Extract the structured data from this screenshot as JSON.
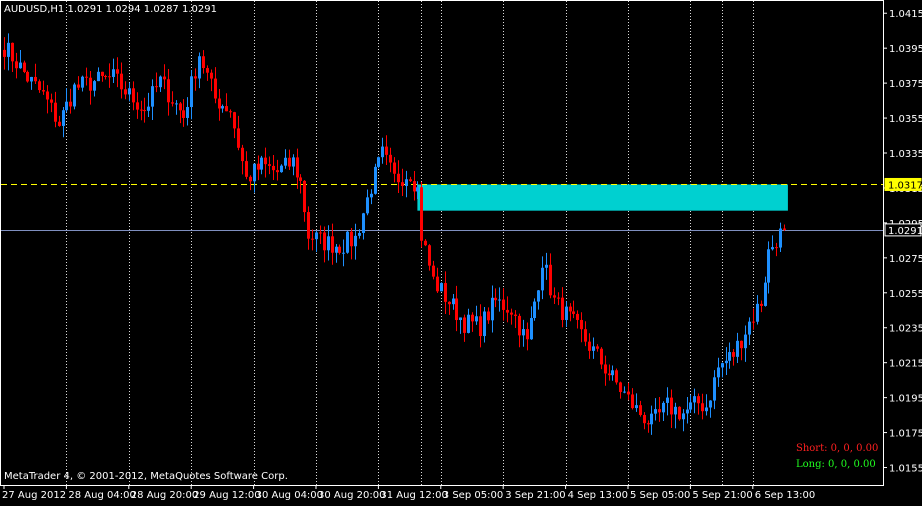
{
  "header": {
    "label": "AUDUSD,H1  1.0291 1.0294 1.0287 1.0291"
  },
  "footer": {
    "copyright": "MetaTrader 4, © 2001-2012, MetaQuotes Software Corp."
  },
  "stats": {
    "short": "Short: 0, 0,  0.00",
    "long": "Long: 0, 0,  0.00"
  },
  "colors": {
    "background": "#000000",
    "bull_candle": "#1e90ff",
    "bear_candle": "#ff0000",
    "grid": "#ffffff",
    "axis_text": "#ffffff",
    "dashed_level": "#ffff00",
    "current_price_line": "#7f8fbf",
    "zone_fill": "#00d0d0",
    "short_text": "#ff2020",
    "long_text": "#20ff20"
  },
  "chart_data": {
    "type": "candlestick",
    "symbol": "AUDUSD",
    "timeframe": "H1",
    "ylim": [
      1.0145,
      1.0422
    ],
    "y_ticks": [
      "1.0415",
      "1.0395",
      "1.0375",
      "1.0355",
      "1.0335",
      "1.0315",
      "1.0295",
      "1.0275",
      "1.0255",
      "1.0235",
      "1.0215",
      "1.0195",
      "1.0175",
      "1.0155"
    ],
    "x_ticks": [
      "27 Aug 2012",
      "28 Aug 04:00",
      "28 Aug 20:00",
      "29 Aug 12:00",
      "30 Aug 04:00",
      "30 Aug 20:00",
      "31 Aug 12:00",
      "3 Sep 05:00",
      "3 Sep 21:00",
      "4 Sep 13:00",
      "5 Sep 05:00",
      "5 Sep 21:00",
      "6 Sep 13:00"
    ],
    "x_tick_bars": [
      0,
      16,
      32,
      48,
      64,
      80,
      96,
      112,
      128,
      144,
      160,
      176,
      192
    ],
    "grid": "vertical dotted",
    "horizontal_levels": [
      {
        "price": 1.0317,
        "label": "1.0317",
        "style": "dashed",
        "color": "#ffff00"
      },
      {
        "price": 1.0291,
        "label": "1.0291",
        "style": "solid",
        "color": "#7f8fbf"
      }
    ],
    "zone": {
      "from_bar": 106,
      "to_bar": 201,
      "top": 1.0317,
      "bottom": 1.0302,
      "color": "#00d0d0"
    },
    "path_keypoints": [
      [
        0,
        1.0396
      ],
      [
        6,
        1.0378
      ],
      [
        10,
        1.0368
      ],
      [
        14,
        1.0352
      ],
      [
        18,
        1.0372
      ],
      [
        23,
        1.0376
      ],
      [
        28,
        1.0378
      ],
      [
        32,
        1.0368
      ],
      [
        36,
        1.036
      ],
      [
        40,
        1.0376
      ],
      [
        46,
        1.0356
      ],
      [
        50,
        1.0392
      ],
      [
        54,
        1.0366
      ],
      [
        58,
        1.036
      ],
      [
        62,
        1.032
      ],
      [
        66,
        1.0328
      ],
      [
        70,
        1.0324
      ],
      [
        74,
        1.033
      ],
      [
        76,
        1.0318
      ],
      [
        78,
        1.0288
      ],
      [
        82,
        1.0284
      ],
      [
        86,
        1.0282
      ],
      [
        90,
        1.0286
      ],
      [
        94,
        1.0316
      ],
      [
        97,
        1.0334
      ],
      [
        100,
        1.032
      ],
      [
        104,
        1.0324
      ],
      [
        106,
        1.0314
      ],
      [
        107,
        1.0288
      ],
      [
        110,
        1.0262
      ],
      [
        114,
        1.025
      ],
      [
        118,
        1.0238
      ],
      [
        122,
        1.0236
      ],
      [
        126,
        1.025
      ],
      [
        130,
        1.0246
      ],
      [
        134,
        1.0226
      ],
      [
        138,
        1.0274
      ],
      [
        141,
        1.025
      ],
      [
        145,
        1.024
      ],
      [
        149,
        1.0228
      ],
      [
        154,
        1.0212
      ],
      [
        158,
        1.02
      ],
      [
        162,
        1.0188
      ],
      [
        166,
        1.018
      ],
      [
        170,
        1.019
      ],
      [
        174,
        1.0186
      ],
      [
        178,
        1.0192
      ],
      [
        180,
        1.019
      ],
      [
        183,
        1.0212
      ],
      [
        187,
        1.022
      ],
      [
        191,
        1.0238
      ],
      [
        194,
        1.025
      ],
      [
        196,
        1.0278
      ],
      [
        198,
        1.0286
      ],
      [
        200,
        1.0291
      ]
    ]
  }
}
